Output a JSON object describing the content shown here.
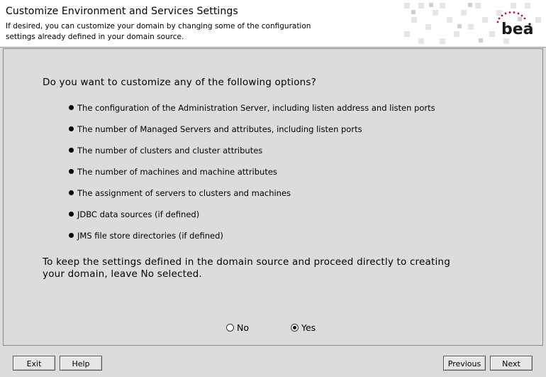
{
  "header": {
    "title": "Customize Environment and Services Settings",
    "description": "If desired, you can customize your domain by changing some of the configuration settings already defined in your domain source.",
    "logo_text": "bea"
  },
  "main": {
    "question": "Do you want to customize any of the following options?",
    "options": [
      "The configuration of the Administration Server, including listen address and listen ports",
      "The number of Managed Servers and attributes, including listen ports",
      "The number of clusters and cluster attributes",
      "The number of machines and machine attributes",
      "The assignment of servers to clusters and machines",
      "JDBC data sources (if defined)",
      "JMS file store directories (if defined)"
    ],
    "keep_text": "To keep the settings defined in the domain source and proceed directly to creating your domain, leave No selected.",
    "radio_no": "No",
    "radio_yes": "Yes",
    "selected": "Yes"
  },
  "footer": {
    "exit": "Exit",
    "help": "Help",
    "previous": "Previous",
    "next": "Next"
  },
  "colors": {
    "background": "#dcdcdc",
    "logo_red": "#c8102e"
  }
}
